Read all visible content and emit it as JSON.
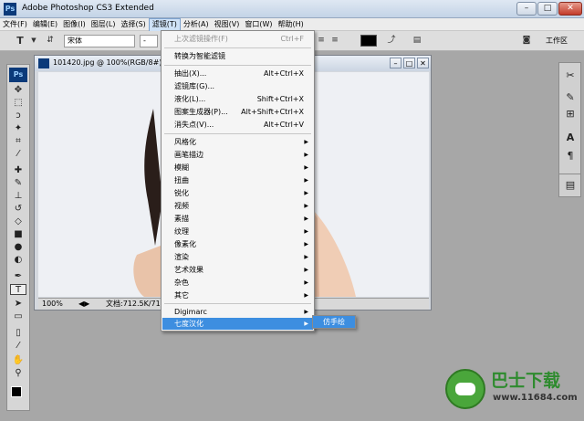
{
  "window": {
    "title": "Adobe Photoshop CS3 Extended",
    "app_icon": "Ps",
    "min": "–",
    "max": "□",
    "close": "✕"
  },
  "menubar": [
    "文件(F)",
    "编辑(E)",
    "图像(I)",
    "图层(L)",
    "选择(S)",
    "滤镜(T)",
    "分析(A)",
    "视图(V)",
    "窗口(W)",
    "帮助(H)"
  ],
  "options": {
    "tool_glyph": "T",
    "font_family": "宋体",
    "font_style": "-",
    "workspace": "工作区"
  },
  "tools": {
    "logo": "Ps"
  },
  "document": {
    "name": "101420.jpg @ 100%(RGB/8#)",
    "zoom": "100%",
    "status": "文档:712.5K/712.5K"
  },
  "filter_menu": {
    "last_filter": {
      "label": "上次滤镜操作(F)",
      "shortcut": "Ctrl+F"
    },
    "smart": "转换为智能滤镜",
    "items1": [
      {
        "label": "抽出(X)...",
        "shortcut": "Alt+Ctrl+X"
      },
      {
        "label": "滤镜库(G)...",
        "shortcut": ""
      },
      {
        "label": "液化(L)...",
        "shortcut": "Shift+Ctrl+X"
      },
      {
        "label": "图案生成器(P)...",
        "shortcut": "Alt+Shift+Ctrl+X"
      },
      {
        "label": "消失点(V)...",
        "shortcut": "Alt+Ctrl+V"
      }
    ],
    "submenus": [
      "风格化",
      "画笔描边",
      "模糊",
      "扭曲",
      "锐化",
      "视频",
      "素描",
      "纹理",
      "像素化",
      "渲染",
      "艺术效果",
      "杂色",
      "其它"
    ],
    "digimarc": "Digimarc",
    "qidu": "七度汉化",
    "qidu_sub": "仿手绘"
  },
  "watermark": {
    "brand": "巴士下载",
    "url": "www.11684.com"
  }
}
